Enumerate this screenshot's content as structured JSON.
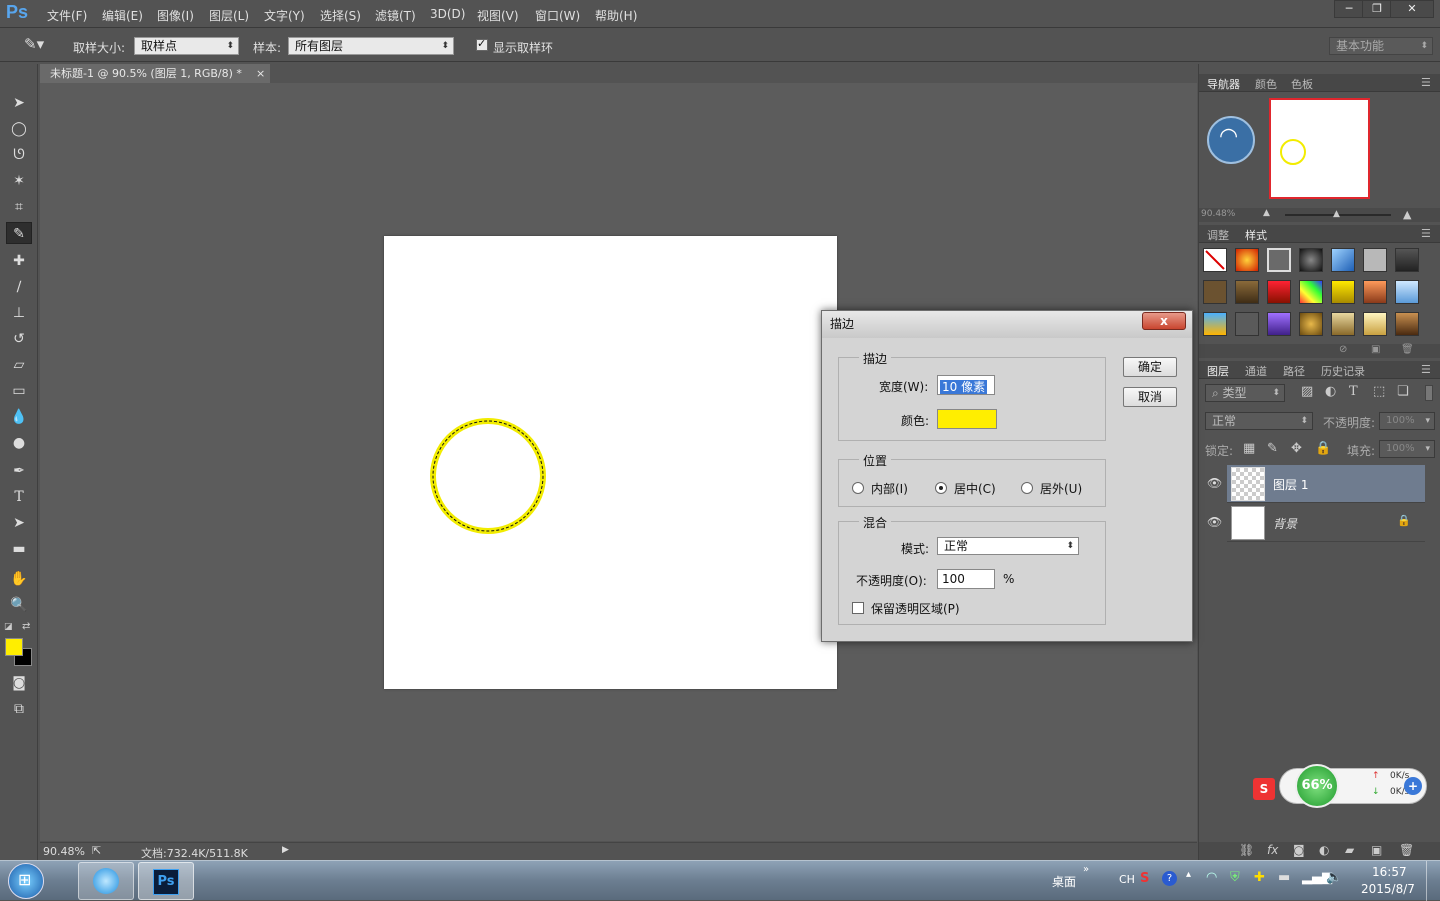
{
  "app": {
    "logo": "Ps"
  },
  "menu": [
    "文件(F)",
    "编辑(E)",
    "图像(I)",
    "图层(L)",
    "文字(Y)",
    "选择(S)",
    "滤镜(T)",
    "3D(D)",
    "视图(V)",
    "窗口(W)",
    "帮助(H)"
  ],
  "window_buttons": {
    "minimize": "─",
    "restore": "❐",
    "close": "✕"
  },
  "options": {
    "sample_size_label": "取样大小:",
    "sample_size_value": "取样点",
    "sample_label": "样本:",
    "sample_value": "所有图层",
    "show_ring_label": "显示取样环",
    "workspace": "基本功能"
  },
  "document": {
    "tab_title": "未标题-1 @ 90.5% (图层 1, RGB/8) *",
    "close": "×"
  },
  "status": {
    "zoom": "90.48%",
    "doc_info": "文档:732.4K/511.8K"
  },
  "navigator": {
    "tabs": [
      "导航器",
      "颜色",
      "色板"
    ],
    "zoom": "90.48%"
  },
  "styles": {
    "tabs": [
      "调整",
      "样式"
    ]
  },
  "layers": {
    "tabs": [
      "图层",
      "通道",
      "路径",
      "历史记录"
    ],
    "filter_label": "类型",
    "blend_mode": "正常",
    "opacity_label": "不透明度:",
    "opacity_value": "100%",
    "lock_label": "锁定:",
    "fill_label": "填充:",
    "fill_value": "100%",
    "items": [
      {
        "name": "图层 1"
      },
      {
        "name": "背景"
      }
    ]
  },
  "dialog": {
    "title": "描边",
    "close": "x",
    "ok": "确定",
    "cancel": "取消",
    "stroke_group": "描边",
    "width_label": "宽度(W):",
    "width_value": "10 像素",
    "color_label": "颜色:",
    "stroke_color": "#ffee00",
    "position_group": "位置",
    "pos_inside": "内部(I)",
    "pos_center": "居中(C)",
    "pos_outside": "居外(U)",
    "blend_group": "混合",
    "mode_label": "模式:",
    "mode_value": "正常",
    "opacity_label": "不透明度(O):",
    "opacity_value": "100",
    "percent": "%",
    "preserve_label": "保留透明区域(P)"
  },
  "widget": {
    "cpu": "66%",
    "up": "0K/s",
    "down": "0K/s"
  },
  "taskbar": {
    "desktop": "桌面",
    "lang": "CH",
    "time": "16:57",
    "date": "2015/8/7"
  },
  "colors": {
    "foreground": "#ffee00",
    "background": "#000000",
    "accent": "#4a8fd8"
  }
}
